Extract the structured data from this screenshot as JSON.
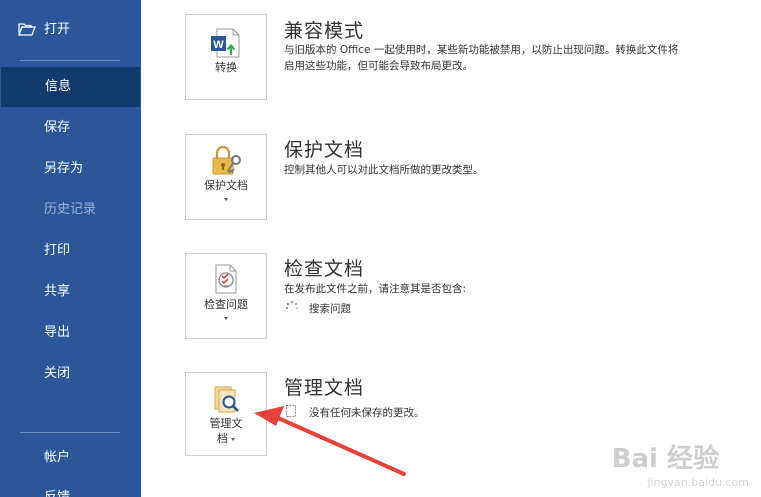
{
  "sidebar": {
    "items": [
      {
        "label": "打开",
        "icon": "folder-open-icon"
      },
      {
        "label": "信息",
        "selected": true
      },
      {
        "label": "保存"
      },
      {
        "label": "另存为"
      },
      {
        "label": "历史记录",
        "disabled": true
      },
      {
        "label": "打印"
      },
      {
        "label": "共享"
      },
      {
        "label": "导出"
      },
      {
        "label": "关闭"
      },
      {
        "label": "帐户"
      },
      {
        "label": "反馈"
      }
    ],
    "bg_color": "#2b579a",
    "selected_color": "#123b6d"
  },
  "sections": [
    {
      "title": "兼容模式",
      "button_label": "转换",
      "icon": "word-convert-icon",
      "desc_line1": "与旧版本的 Office 一起使用时，某些新功能被禁用，以防止出现问题。转换此文件将",
      "desc_line2": "启用这些功能，但可能会导致布局更改。"
    },
    {
      "title": "保护文档",
      "button_label": "保护文档",
      "icon": "lock-key-icon",
      "desc_line1": "控制其他人可以对此文档所做的更改类型。"
    },
    {
      "title": "检查文档",
      "button_label": "检查问题",
      "icon": "checklist-icon",
      "desc_line1": "在发布此文件之前，请注意其是否包含:",
      "sub_item": "搜索问题"
    },
    {
      "title": "管理文档",
      "button_label_line1": "管理文",
      "button_label_line2": "档",
      "icon": "manage-document-icon",
      "sub_item": "没有任何未保存的更改。"
    }
  ],
  "watermark": {
    "main": "Bai 经验",
    "sub": "jingyan.baidu.com"
  },
  "annotation_color": "#e8403a"
}
